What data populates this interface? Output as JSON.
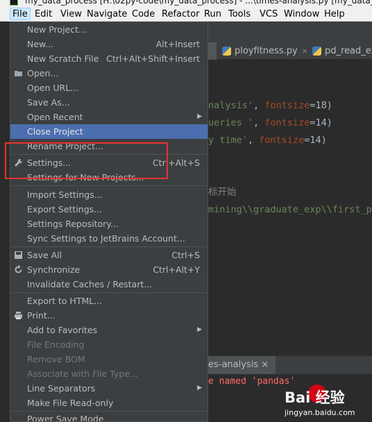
{
  "window": {
    "title": "my_data_process [H:\\02py-code\\my_data_process] - ...\\times-analysis.py [my_data_p"
  },
  "menubar": {
    "items": [
      "File",
      "Edit",
      "View",
      "Navigate",
      "Code",
      "Refactor",
      "Run",
      "Tools",
      "VCS",
      "Window",
      "Help"
    ]
  },
  "editor": {
    "tabs": [
      {
        "label": "ployfitness.py",
        "close": "×"
      },
      {
        "label": "pd_read_exc",
        "close": ""
      }
    ],
    "code_lines": [
      {
        "a": "nalysis'",
        "b": ", ",
        "c": "fontsize",
        "d": "=18)"
      },
      {
        "a": "ueries  '",
        "b": ", ",
        "c": "fontsize",
        "d": "=14)"
      },
      {
        "a": "y time'",
        "b": ", ",
        "c": "fontsize",
        "d": "=14)"
      }
    ],
    "comment_line": "标开始",
    "path_line": "mining\\\\graduate_exp\\\\first_pi",
    "bottom_tab": "es-analysis ×",
    "console_error": "e named 'pandas'"
  },
  "file_menu": {
    "items": [
      {
        "label": "New Project...",
        "shortcut": "",
        "submenu": false,
        "disabled": false,
        "selected": false,
        "icon": ""
      },
      {
        "label": "New...",
        "shortcut": "Alt+Insert",
        "submenu": false,
        "disabled": false,
        "selected": false,
        "icon": ""
      },
      {
        "label": "New Scratch File",
        "shortcut": "Ctrl+Alt+Shift+Insert",
        "submenu": false,
        "disabled": false,
        "selected": false,
        "icon": ""
      },
      {
        "label": "Open...",
        "shortcut": "",
        "submenu": false,
        "disabled": false,
        "selected": false,
        "icon": "folder-icon"
      },
      {
        "label": "Open URL...",
        "shortcut": "",
        "submenu": false,
        "disabled": false,
        "selected": false,
        "icon": ""
      },
      {
        "label": "Save As...",
        "shortcut": "",
        "submenu": false,
        "disabled": false,
        "selected": false,
        "icon": ""
      },
      {
        "label": "Open Recent",
        "shortcut": "",
        "submenu": true,
        "disabled": false,
        "selected": false,
        "icon": ""
      },
      {
        "label": "Close Project",
        "shortcut": "",
        "submenu": false,
        "disabled": false,
        "selected": true,
        "icon": ""
      },
      {
        "label": "Rename Project...",
        "shortcut": "",
        "submenu": false,
        "disabled": false,
        "selected": false,
        "icon": ""
      },
      {
        "label": "Settings...",
        "shortcut": "Ctrl+Alt+S",
        "submenu": false,
        "disabled": false,
        "selected": false,
        "icon": "wrench-icon"
      },
      {
        "label": "Settings for New Projects...",
        "shortcut": "",
        "submenu": false,
        "disabled": false,
        "selected": false,
        "icon": ""
      },
      {
        "label": "Import Settings...",
        "shortcut": "",
        "submenu": false,
        "disabled": false,
        "selected": false,
        "icon": ""
      },
      {
        "label": "Export Settings...",
        "shortcut": "",
        "submenu": false,
        "disabled": false,
        "selected": false,
        "icon": ""
      },
      {
        "label": "Settings Repository...",
        "shortcut": "",
        "submenu": false,
        "disabled": false,
        "selected": false,
        "icon": ""
      },
      {
        "label": "Sync Settings to JetBrains Account...",
        "shortcut": "",
        "submenu": false,
        "disabled": false,
        "selected": false,
        "icon": ""
      },
      {
        "label": "Save All",
        "shortcut": "Ctrl+S",
        "submenu": false,
        "disabled": false,
        "selected": false,
        "icon": "save-icon"
      },
      {
        "label": "Synchronize",
        "shortcut": "Ctrl+Alt+Y",
        "submenu": false,
        "disabled": false,
        "selected": false,
        "icon": "sync-icon"
      },
      {
        "label": "Invalidate Caches / Restart...",
        "shortcut": "",
        "submenu": false,
        "disabled": false,
        "selected": false,
        "icon": ""
      },
      {
        "label": "Export to HTML...",
        "shortcut": "",
        "submenu": false,
        "disabled": false,
        "selected": false,
        "icon": ""
      },
      {
        "label": "Print...",
        "shortcut": "",
        "submenu": false,
        "disabled": false,
        "selected": false,
        "icon": "printer-icon"
      },
      {
        "label": "Add to Favorites",
        "shortcut": "",
        "submenu": true,
        "disabled": false,
        "selected": false,
        "icon": ""
      },
      {
        "label": "File Encoding",
        "shortcut": "",
        "submenu": false,
        "disabled": true,
        "selected": false,
        "icon": ""
      },
      {
        "label": "Remove BOM",
        "shortcut": "",
        "submenu": false,
        "disabled": true,
        "selected": false,
        "icon": ""
      },
      {
        "label": "Associate with File Type...",
        "shortcut": "",
        "submenu": false,
        "disabled": true,
        "selected": false,
        "icon": ""
      },
      {
        "label": "Line Separators",
        "shortcut": "",
        "submenu": true,
        "disabled": false,
        "selected": false,
        "icon": ""
      },
      {
        "label": "Make File Read-only",
        "shortcut": "",
        "submenu": false,
        "disabled": false,
        "selected": false,
        "icon": ""
      },
      {
        "label": "Power Save Mode",
        "shortcut": "",
        "submenu": false,
        "disabled": false,
        "selected": false,
        "icon": ""
      }
    ]
  },
  "watermark": {
    "brand": "Bai 经验",
    "url": "jingyan.baidu.com"
  },
  "colors": {
    "menu_bg": "#3c3f41",
    "selection": "#4b6eaf",
    "highlight_box": "#e8322f"
  }
}
